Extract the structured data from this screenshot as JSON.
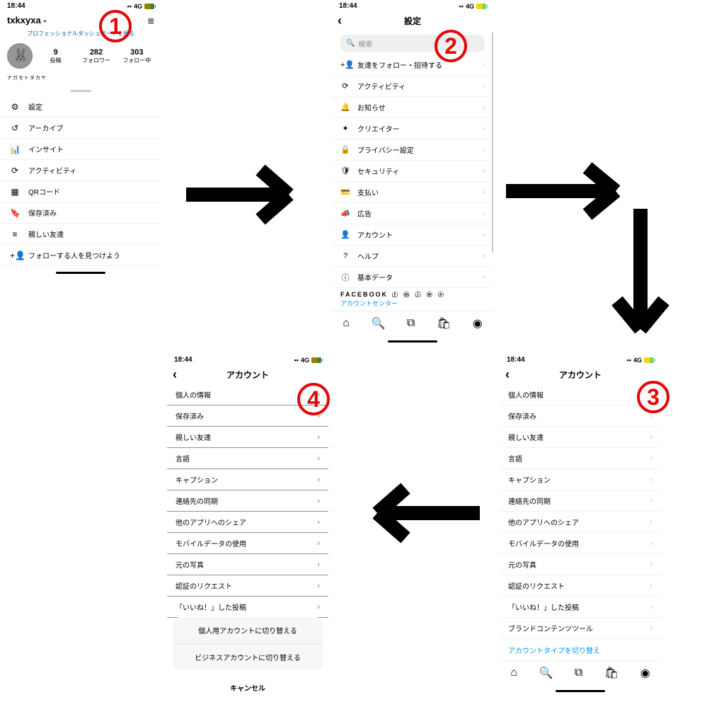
{
  "status": {
    "time": "18:44",
    "net": "4G",
    "signal": "▪▪"
  },
  "steps": [
    "1",
    "2",
    "3",
    "4"
  ],
  "p1": {
    "username": "txkxyxa",
    "dashboard": "プロフェッショナルダッシュボードを見る",
    "stats": [
      {
        "num": "9",
        "label": "投稿"
      },
      {
        "num": "282",
        "label": "フォロワー"
      },
      {
        "num": "303",
        "label": "フォロー中"
      }
    ],
    "display_name": "ナガモトタカヤ",
    "menu": [
      {
        "icon": "⚙",
        "label": "設定"
      },
      {
        "icon": "↺",
        "label": "アーカイブ"
      },
      {
        "icon": "📊",
        "label": "インサイト"
      },
      {
        "icon": "⟳",
        "label": "アクティビティ"
      },
      {
        "icon": "▦",
        "label": "QRコード"
      },
      {
        "icon": "🔖",
        "label": "保存済み"
      },
      {
        "icon": "≡",
        "label": "親しい友達"
      },
      {
        "icon": "+👤",
        "label": "フォローする人を見つけよう"
      }
    ]
  },
  "p2": {
    "title": "設定",
    "search": "検索",
    "items": [
      {
        "icon": "+👤",
        "label": "友達をフォロー・招待する"
      },
      {
        "icon": "⟳",
        "label": "アクティビティ"
      },
      {
        "icon": "🔔",
        "label": "お知らせ"
      },
      {
        "icon": "✦",
        "label": "クリエイター"
      },
      {
        "icon": "🔒",
        "label": "プライバシー設定"
      },
      {
        "icon": "🛡",
        "label": "セキュリティ"
      },
      {
        "icon": "💳",
        "label": "支払い"
      },
      {
        "icon": "📣",
        "label": "広告"
      },
      {
        "icon": "👤",
        "label": "アカウント"
      },
      {
        "icon": "?",
        "label": "ヘルプ"
      },
      {
        "icon": "ⓘ",
        "label": "基本データ"
      }
    ],
    "facebook": "FACEBOOK",
    "fblink": "アカウントセンター"
  },
  "p3": {
    "title": "アカウント",
    "items": [
      "個人の情報",
      "保存済み",
      "親しい友達",
      "言語",
      "キャプション",
      "連絡先の同期",
      "他のアプリへのシェア",
      "モバイルデータの使用",
      "元の写真",
      "認証のリクエスト",
      "「いいね！」した投稿",
      "ブランドコンテンツツール"
    ],
    "switch": "アカウントタイプを切り替え"
  },
  "p4": {
    "title": "アカウント",
    "items": [
      "個人の情報",
      "保存済み",
      "親しい友達",
      "言語",
      "キャプション",
      "連絡先の同期",
      "他のアプリへのシェア",
      "モバイルデータの使用",
      "元の写真",
      "認証のリクエスト",
      "「いいね！」した投稿"
    ],
    "popup": {
      "opt1": "個人用アカウントに切り替える",
      "opt2": "ビジネスアカウントに切り替える",
      "cancel": "キャンセル"
    }
  },
  "nav_icons": [
    "⌂",
    "🔍",
    "⧉",
    "🛍",
    "◉"
  ]
}
